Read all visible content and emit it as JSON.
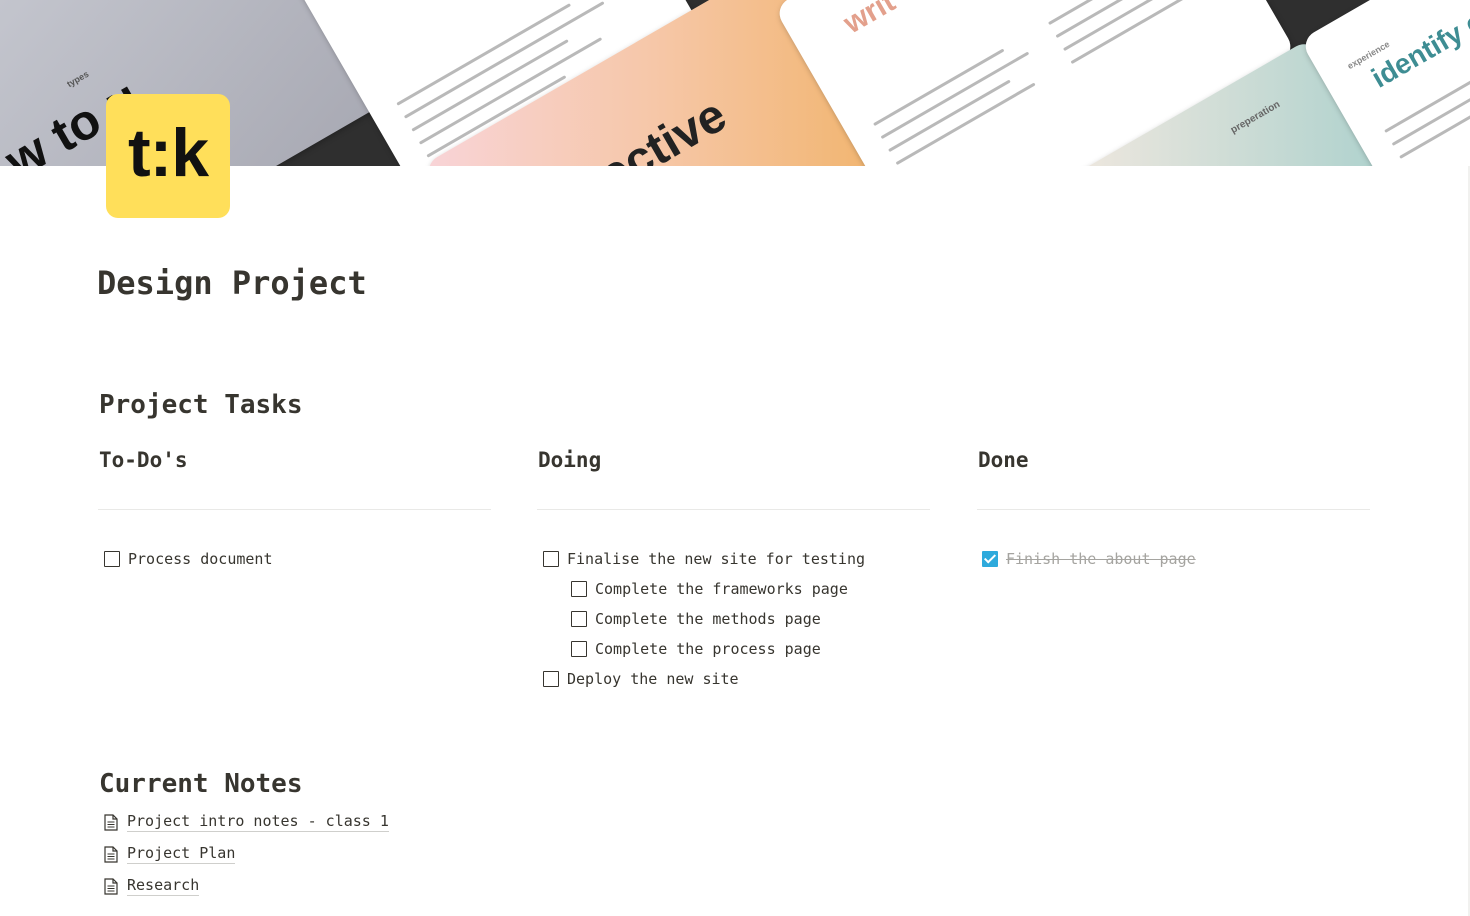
{
  "cover": {
    "words": [
      "w to u",
      "types",
      "ective",
      "writ",
      "preperation",
      "identify c",
      "experience"
    ]
  },
  "logo": {
    "text": "t:k"
  },
  "page": {
    "title": "Design Project"
  },
  "tasks_section": {
    "heading": "Project Tasks",
    "columns": [
      {
        "title": "To-Do's",
        "items": [
          {
            "label": "Process document",
            "checked": false
          }
        ]
      },
      {
        "title": "Doing",
        "items": [
          {
            "label": "Finalise the new site for testing",
            "checked": false
          },
          {
            "label": "Complete the frameworks page",
            "checked": false
          },
          {
            "label": "Complete the methods page",
            "checked": false
          },
          {
            "label": "Complete the process page",
            "checked": false
          },
          {
            "label": "Deploy the new site",
            "checked": false
          }
        ]
      },
      {
        "title": "Done",
        "items": [
          {
            "label": "Finish the about page",
            "checked": true
          }
        ]
      }
    ]
  },
  "notes_section": {
    "heading": "Current Notes",
    "items": [
      "Project intro notes - class 1",
      "Project Plan",
      "Research"
    ]
  },
  "icons": {
    "checkbox": "checkbox-icon",
    "document": "document-icon"
  },
  "colors": {
    "logo_bg": "#ffdf5a",
    "checked": "#2eaadc",
    "text": "#37352f"
  }
}
